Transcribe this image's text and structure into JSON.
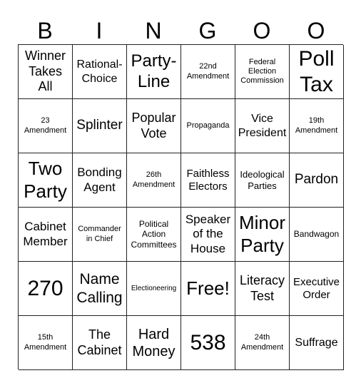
{
  "header": [
    "B",
    "I",
    "N",
    "G",
    "O",
    "O"
  ],
  "cells": [
    [
      "Winner Takes All",
      "Rational-Choice",
      "Party-Line",
      "22nd Amendment",
      "Federal Election Commission",
      "Poll Tax"
    ],
    [
      "23 Amendment",
      "Splinter",
      "Popular Vote",
      "Propaganda",
      "Vice President",
      "19th Amendment"
    ],
    [
      "Two Party",
      "Bonding Agent",
      "26th Amendment",
      "Faithless Electors",
      "Ideological Parties",
      "Pardon"
    ],
    [
      "Cabinet Member",
      "Commander in Chief",
      "Political Action Committees",
      "Speaker of the House",
      "Minor Party",
      "Bandwagon"
    ],
    [
      "270",
      "Name Calling",
      "Electioneering",
      "Free!",
      "Literacy Test",
      "Executive Order"
    ],
    [
      "15th Amendment",
      "The Cabinet",
      "Hard Money",
      "538",
      "24th Amendment",
      "Suffrage"
    ]
  ]
}
